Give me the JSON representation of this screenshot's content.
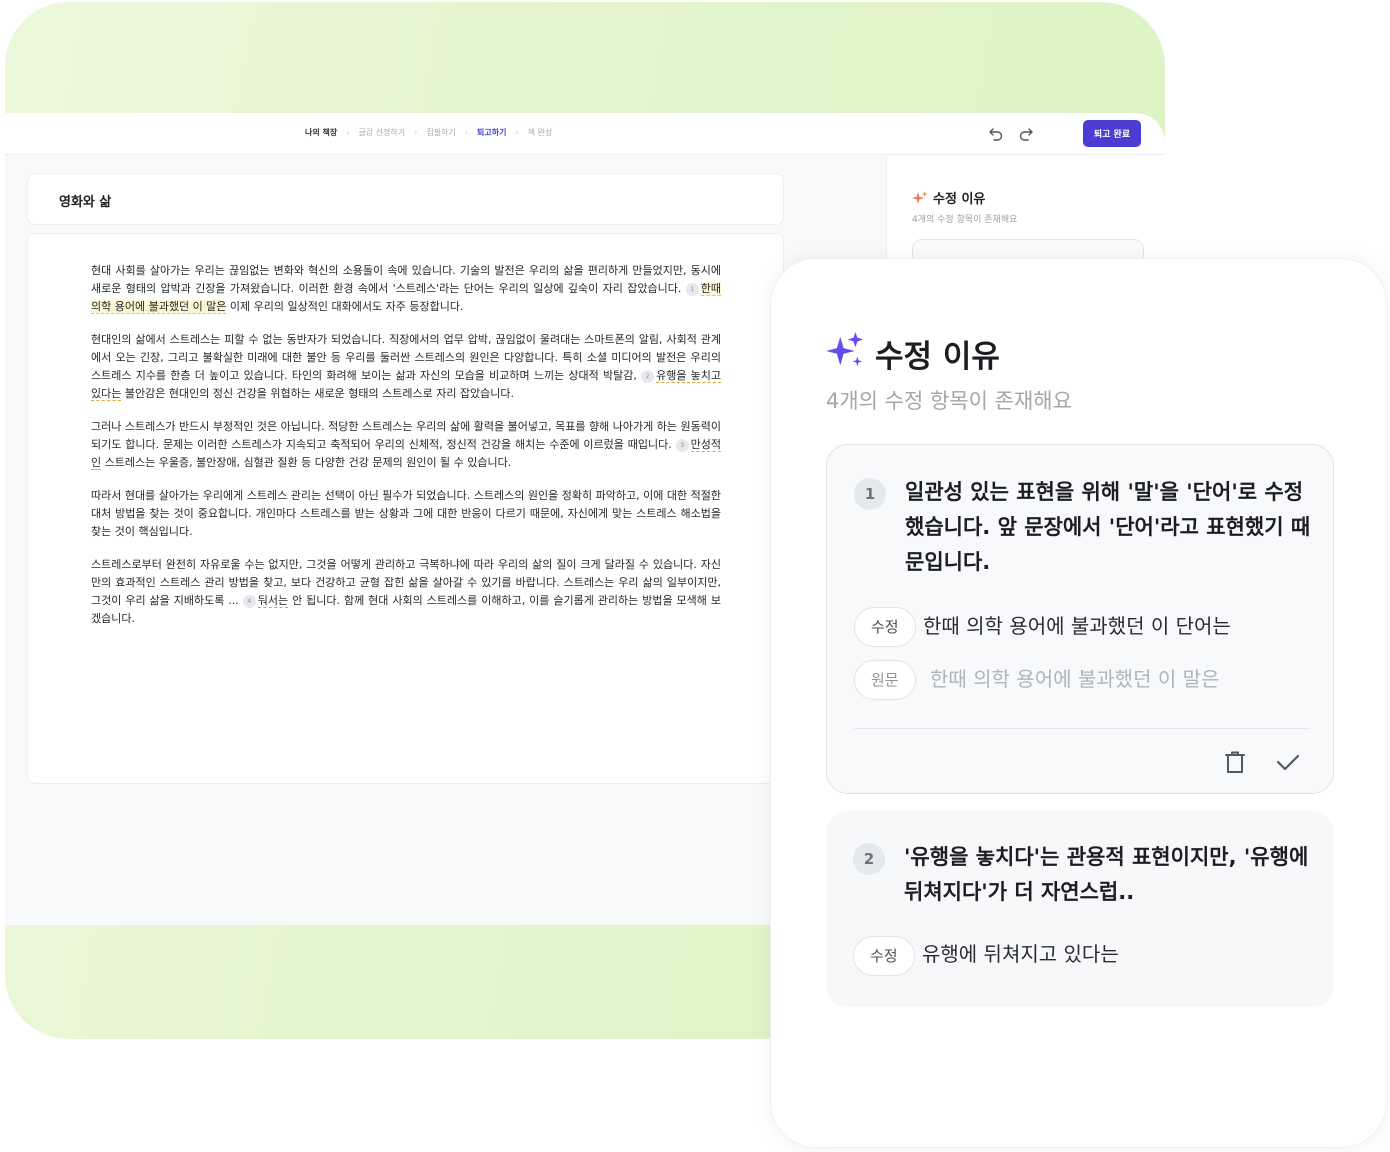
{
  "breadcrumb": {
    "items": [
      "나의 책장",
      "글감 선정하기",
      "집필하기",
      "퇴고하기",
      "책 완성"
    ],
    "separator": "›"
  },
  "toolbar": {
    "undo_icon": "undo-icon",
    "redo_icon": "redo-icon",
    "complete_label": "퇴고 완료"
  },
  "document": {
    "title": "영화와 삶",
    "p1_a": "현대 사회를 살아가는 우리는 끊임없는 변화와 혁신의 소용돌이 속에 있습니다. 기술의 발전은 우리의 삶을 편리하게 만들었지만, 동시에 새로운 형태의 압박과 긴장을 가져왔습니다. 이러한 환경 속에서 '스트레스'라는 단어는 우리의 일상에 깊숙이 자리 잡았습니다.",
    "p1_num": "1",
    "p1_mark": "한때 의학 용어에 불과했던 이 말은",
    "p1_b": " 이제 우리의 일상적인 대화에서도 자주 등장합니다.",
    "p2_a": "현대인의 삶에서 스트레스는 피할 수 없는 동반자가 되었습니다. 직장에서의 업무 압박, 끊임없이 울려대는 스마트폰의 알림, 사회적 관계에서 오는 긴장, 그리고 불확실한 미래에 대한 불안 등 우리를 둘러싼 스트레스의 원인은 다양합니다. 특히 소셜 미디어의 발전은 우리의 스트레스 지수를 한층 더 높이고 있습니다. 타인의 화려해 보이는 삶과 자신의 모습을 비교하며 느끼는 상대적 박탈감,",
    "p2_num": "2",
    "p2_mark": "유행을 놓치고 있다는",
    "p2_b": " 불안감은 현대인의 정신 건강을 위협하는 새로운 형태의 스트레스로 자리 잡았습니다.",
    "p3_a": "그러나 스트레스가 반드시 부정적인 것은 아닙니다. 적당한 스트레스는 우리의 삶에 활력을 불어넣고, 목표를 향해 나아가게 하는 원동력이 되기도 합니다. 문제는 이러한 스트레스가 지속되고 축적되어 우리의 신체적, 정신적 건강을 해치는 수준에 이르렀을 때입니다.",
    "p3_num": "3",
    "p3_mark": "만성적인",
    "p3_b": " 스트레스는 우울증, 불안장애, 심혈관 질환 등 다양한 건강 문제의 원인이 될 수 있습니다.",
    "p4": "따라서 현대를 살아가는 우리에게 스트레스 관리는 선택이 아닌 필수가 되었습니다. 스트레스의 원인을 정확히 파악하고, 이에 대한 적절한 대처 방법을 찾는 것이 중요합니다. 개인마다 스트레스를 받는 상황과 그에 대한 반응이 다르기 때문에, 자신에게 맞는 스트레스 해소법을 찾는 것이 핵심입니다.",
    "p5_a": "스트레스로부터 완전히 자유로울 수는 없지만, 그것을 어떻게 관리하고 극복하냐에 따라 우리의 삶의 질이 크게 달라질 수 있습니다. 자신만의 효과적인 스트레스 관리 방법을 찾고, 보다 건강하고 균형 잡힌 삶을 살아갈 수 있기를 바랍니다. 스트레스는 우리 삶의 일부이지만, 그것이 우리 삶을 지배하도록 ...",
    "p5_num": "4",
    "p5_mark": "둬서는",
    "p5_b": " 안 됩니다. 함께 현대 사회의 스트레스를 이해하고, 이를 슬기롭게 관리하는 방법을 모색해 보겠습니다."
  },
  "sidebar": {
    "title": "수정 이유",
    "subtitle": "4개의 수정 항목이 존재해요"
  },
  "panel": {
    "title": "수정 이유",
    "subtitle": "4개의 수정 항목이 존재해요",
    "revised_label": "수정",
    "original_label": "원문",
    "cards": [
      {
        "number": "1",
        "reason": "일관성 있는 표현을 위해 '말'을 '단어'로 수정했습니다. 앞 문장에서 '단어'라고 표현했기 때문입니다.",
        "revised": "한때 의학 용어에 불과했던 이 단어는",
        "original": "한때 의학 용어에 불과했던 이 말은"
      },
      {
        "number": "2",
        "reason": "'유행을 놓치다'는 관용적 표현이지만, '유행에 뒤쳐지다'가 더 자연스럽..",
        "revised": "유행에 뒤쳐지고 있다는"
      }
    ],
    "delete_icon": "trash-icon",
    "accept_icon": "check-icon"
  },
  "colors": {
    "accent": "#4b3dd4",
    "sparkle_purple": "#6a3cf0",
    "highlight": "#fcf6d2",
    "background_green": "#e2f5cc"
  }
}
